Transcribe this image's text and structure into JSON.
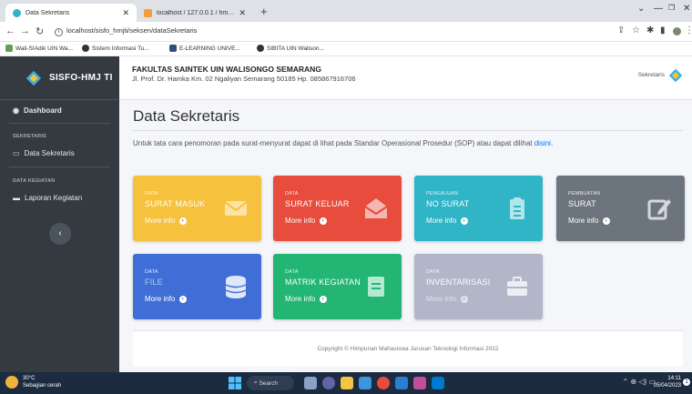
{
  "browser": {
    "tabs": [
      {
        "title": "Data Sekretaris",
        "active": true
      },
      {
        "title": "localhost / 127.0.0.1 / hmjti_db |",
        "active": false
      }
    ],
    "url": "localhost/sisfo_hmjti/seksen/dataSekretaris",
    "bookmarks": [
      "Wali-SIAdik UIN Wa...",
      "Sistem Informasi Tu...",
      "E-LEARNING UNIVE...",
      "SIBITA UIN Walison..."
    ]
  },
  "sidebar": {
    "brand": "SISFO-HMJ TI",
    "dashboard_label": "Dashboard",
    "section_sekretaris": "SEKRETARIS",
    "data_sekretaris_label": "Data Sekretaris",
    "section_kegiatan": "DATA KEGIATAN",
    "laporan_label": "Laporan Kegiatan",
    "toggle_glyph": "‹"
  },
  "header": {
    "faculty": "FAKULTAS SAINTEK UIN WALISONGO SEMARANG",
    "address": "Jl. Prof. Dr. Hamka Km. 02 Ngaliyan Semarang 50185 Hp. 085867916706",
    "role": "Sekretaris"
  },
  "main": {
    "title": "Data Sekretaris",
    "intro_text": "Untuk tata cara penomoran pada surat-menyurat dapat di lihat pada Standar Operasional Prosedur (SOP) atau dapat dilihat",
    "intro_link": "disini",
    "more_info": "More info",
    "boxes": [
      {
        "small": "DATA",
        "title": "SURAT MASUK",
        "color": "#f6c13c",
        "icon": "envelope-icon"
      },
      {
        "small": "DATA",
        "title": "SURAT KELUAR",
        "color": "#e74c3c",
        "icon": "envelope-open-icon"
      },
      {
        "small": "PENGAJUAN",
        "title": "NO SURAT",
        "color": "#2fb5c6",
        "icon": "clipboard-icon"
      },
      {
        "small": "PEMBUATAN",
        "title": "SURAT",
        "color": "#6c757d",
        "icon": "edit-icon"
      },
      {
        "small": "DATA",
        "title": "FILE",
        "color": "#3f6fd6",
        "icon": "database-icon"
      },
      {
        "small": "DATA",
        "title": "MATRIK KEGIATAN",
        "color": "#22b573",
        "icon": "book-icon"
      },
      {
        "small": "DATA",
        "title": "INVENTARISASI",
        "color": "#b2b6c8",
        "icon": "briefcase-icon"
      }
    ]
  },
  "footer": {
    "text": "Copyright © Himpunan Mahasiswa Jurusan Teknologi Informasi 2022"
  },
  "taskbar": {
    "temp": "30°C",
    "weather": "Sebagian cerah",
    "search": "Search",
    "time": "14:11",
    "date": "05/04/2023",
    "notifications": "1"
  }
}
